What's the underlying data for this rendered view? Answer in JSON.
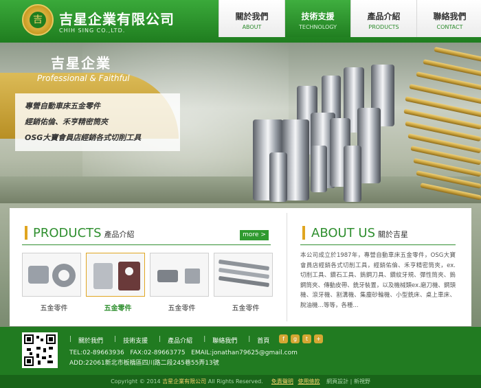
{
  "header": {
    "logo_cn": "吉星企業有限公司",
    "logo_en": "CHIH SING CO.,LTD.",
    "logo_mark": "吉"
  },
  "nav": [
    {
      "cn": "關於我們",
      "en": "ABOUT"
    },
    {
      "cn": "技術支援",
      "en": "TECHNOLOGY"
    },
    {
      "cn": "產品介紹",
      "en": "PRODUCTS"
    },
    {
      "cn": "聯絡我們",
      "en": "CONTACT"
    }
  ],
  "banner": {
    "title": "吉星企業",
    "subtitle": "Professional  & Faithful",
    "lines": [
      "專營自動車床五金零件",
      "經銷佑倫、禾亨精密筒夾",
      "OSG大寶會員店經銷各式切削工具"
    ]
  },
  "products": {
    "title": "PRODUCTS",
    "subtitle": "產品介紹",
    "more": "more >",
    "items": [
      {
        "label": "五金零件"
      },
      {
        "label": "五金零件"
      },
      {
        "label": "五金零件"
      },
      {
        "label": "五金零件"
      }
    ]
  },
  "about": {
    "title": "ABOUT US",
    "subtitle": "關於吉星",
    "text": "本公司成立於1987年，專營自動車床五金零件，OSG大寶會員店經銷各式切削工具，經銷佑倫、禾亨精密筒夾，ex. 切削工具、鑽石工具、鎢鋼刀具、鑽紋牙規、彈性筒夾、鎢鋼筒夾、傳動皮帶、銑牙裝置，以及機械類ex.磨刀機、鋼頭機、滾牙機、割溝機、集塵砂輪機、小型銑床、桌上車床、脫油機…等等，各種..."
  },
  "footer": {
    "nav": [
      "關於我們",
      "技術支援",
      "產品介紹",
      "聯絡我們",
      "首頁"
    ],
    "social": [
      "f",
      "g",
      "t",
      "+"
    ],
    "tel": "TEL:02-89663936",
    "fax": "FAX:02-89663775",
    "email": "EMAIL:jonathan79625@gmail.com",
    "address": "ADD:22061新北市板橋區四川路二段245巷55弄13號",
    "copyright_pre": "Copyright © 2014",
    "copyright_company": "吉星企業有限公司",
    "copyright_post": "All Rights Reserved.",
    "link_disclaimer": "免責聲明",
    "link_privacy": "使用條款",
    "design": "網頁設計 | 新視野"
  }
}
